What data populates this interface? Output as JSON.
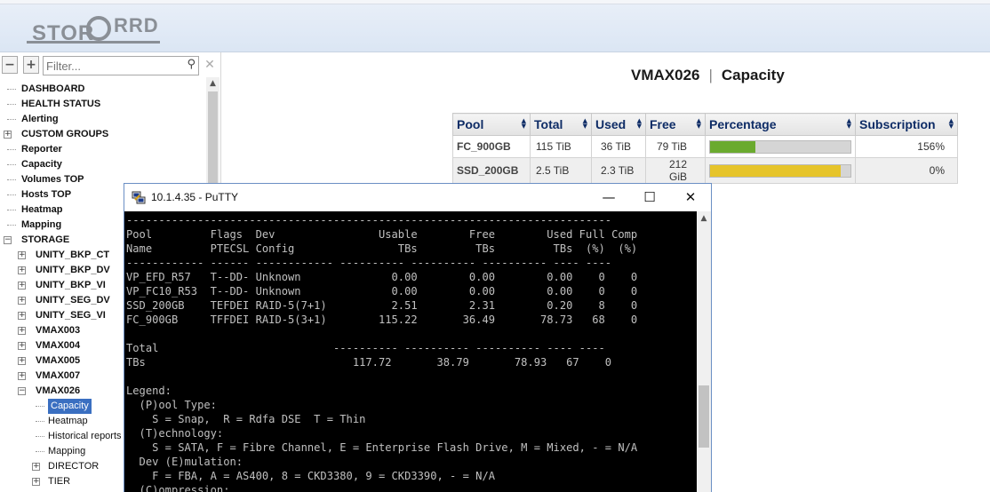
{
  "header": {
    "logo_left": "STOR",
    "logo_right": "RRD"
  },
  "leftpanel": {
    "collapse_label": "−",
    "expand_label": "+",
    "filter_placeholder": "Filter...",
    "clear_label": "✕"
  },
  "tree": [
    {
      "label": "DASHBOARD",
      "level": 0,
      "expander": ""
    },
    {
      "label": "HEALTH STATUS",
      "level": 0,
      "expander": ""
    },
    {
      "label": "Alerting",
      "level": 0,
      "expander": ""
    },
    {
      "label": "CUSTOM GROUPS",
      "level": 0,
      "expander": "+"
    },
    {
      "label": "Reporter",
      "level": 0,
      "expander": ""
    },
    {
      "label": "Capacity",
      "level": 0,
      "expander": ""
    },
    {
      "label": "Volumes TOP",
      "level": 0,
      "expander": ""
    },
    {
      "label": "Hosts TOP",
      "level": 0,
      "expander": ""
    },
    {
      "label": "Heatmap",
      "level": 0,
      "expander": ""
    },
    {
      "label": "Mapping",
      "level": 0,
      "expander": ""
    },
    {
      "label": "STORAGE",
      "level": 0,
      "expander": "−"
    },
    {
      "label": "UNITY_BKP_CT",
      "level": 1,
      "expander": "+"
    },
    {
      "label": "UNITY_BKP_DV",
      "level": 1,
      "expander": "+"
    },
    {
      "label": "UNITY_BKP_VI",
      "level": 1,
      "expander": "+"
    },
    {
      "label": "UNITY_SEG_DV",
      "level": 1,
      "expander": "+"
    },
    {
      "label": "UNITY_SEG_VI",
      "level": 1,
      "expander": "+"
    },
    {
      "label": "VMAX003",
      "level": 1,
      "expander": "+"
    },
    {
      "label": "VMAX004",
      "level": 1,
      "expander": "+"
    },
    {
      "label": "VMAX005",
      "level": 1,
      "expander": "+"
    },
    {
      "label": "VMAX007",
      "level": 1,
      "expander": "+"
    },
    {
      "label": "VMAX026",
      "level": 1,
      "expander": "−"
    },
    {
      "label": "Capacity",
      "level": 2,
      "expander": "",
      "selected": true
    },
    {
      "label": "Heatmap",
      "level": 2,
      "expander": ""
    },
    {
      "label": "Historical reports",
      "level": 2,
      "expander": ""
    },
    {
      "label": "Mapping",
      "level": 2,
      "expander": ""
    },
    {
      "label": "DIRECTOR",
      "level": 2,
      "expander": "+"
    },
    {
      "label": "TIER",
      "level": 2,
      "expander": "+"
    }
  ],
  "main": {
    "system": "VMAX026",
    "separator": "|",
    "page": "Capacity",
    "columns": [
      "Pool",
      "Total",
      "Used",
      "Free",
      "Percentage",
      "Subscription"
    ],
    "rows": [
      {
        "pool": "FC_900GB",
        "total": "115 TiB",
        "used": "36 TiB",
        "free": "79 TiB",
        "pct": 0.32,
        "bar_color": "#6aaa2e",
        "subscription": "156%"
      },
      {
        "pool": "SSD_200GB",
        "total": "2.5 TiB",
        "used": "2.3 TiB",
        "free": "212 GiB",
        "pct": 0.93,
        "bar_color": "#e6c42a",
        "subscription": "0%"
      }
    ]
  },
  "putty": {
    "title": "10.1.4.35 - PuTTY",
    "minimize": "—",
    "maximize": "☐",
    "close": "✕",
    "terminal_lines": [
      "---------------------------------------------------------------------------",
      "Pool         Flags  Dev                Usable        Free        Used Full Comp",
      "Name         PTECSL Config                TBs         TBs         TBs  (%)  (%)",
      "------------ ------ ------------ ---------- ---------- ---------- ---- ----",
      "VP_EFD_R57   T--DD- Unknown              0.00        0.00        0.00    0    0",
      "VP_FC10_R53  T--DD- Unknown              0.00        0.00        0.00    0    0",
      "SSD_200GB    TEFDEI RAID-5(7+1)          2.51        2.31        0.20    8    0",
      "FC_900GB     TFFDEI RAID-5(3+1)        115.22       36.49       78.73   68    0",
      "",
      "Total                           ---------- ---------- ---------- ---- ----",
      "TBs                                117.72       38.79       78.93   67    0",
      "",
      "Legend:",
      "  (P)ool Type:",
      "    S = Snap,  R = Rdfa DSE  T = Thin",
      "  (T)echnology:",
      "    S = SATA, F = Fibre Channel, E = Enterprise Flash Drive, M = Mixed, - = N/A",
      "  Dev (E)mulation:",
      "    F = FBA, A = AS400, 8 = CKD3380, 9 = CKD3390, - = N/A",
      "  (C)ompression:"
    ]
  }
}
